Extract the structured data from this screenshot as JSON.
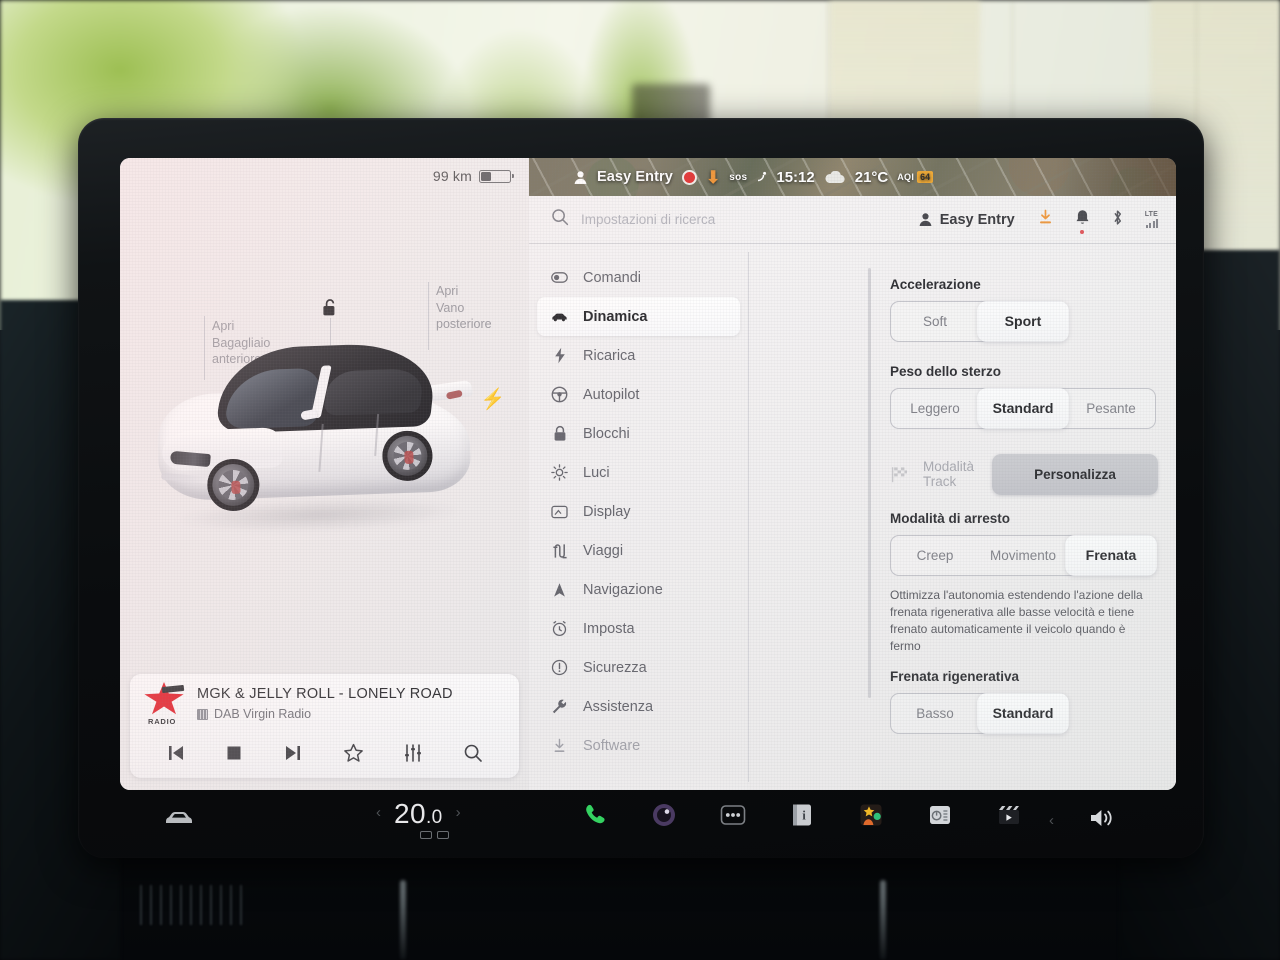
{
  "status_bar": {
    "profile_icon": "person-icon",
    "profile_name": "Easy Entry",
    "recording_icon": "record-dot-icon",
    "download_icon": "download-arrow-icon",
    "sos_label": "sos",
    "clock": "15:12",
    "weather_icon": "cloud-icon",
    "temperature": "21°C",
    "aqi_label": "AQI",
    "aqi_value": "64"
  },
  "car_panel": {
    "range": "99 km",
    "battery_percent": 35,
    "hint_left": "Apri\nBagagliaio\nanteriore",
    "hint_left_line1": "Apri",
    "hint_left_line2": "Bagagliaio",
    "hint_left_line3": "anteriore",
    "hint_right_line1": "Apri",
    "hint_right_line2": "Vano",
    "hint_right_line3": "posteriore",
    "lock_icon": "unlocked-padlock-icon",
    "charge_port_icon": "lightning-bolt-icon",
    "vehicle_image": "tesla-model-3-white"
  },
  "media": {
    "station_logo": "virgin-radio-logo",
    "logo_text": "RADIO",
    "track_title": "MGK & JELLY ROLL - LONELY ROAD",
    "source_icon": "dab-tuner-icon",
    "source": "DAB Virgin Radio",
    "controls": [
      {
        "name": "previous-track-button",
        "icon": "skip-back-icon"
      },
      {
        "name": "stop-button",
        "icon": "stop-square-icon"
      },
      {
        "name": "next-track-button",
        "icon": "skip-forward-icon"
      },
      {
        "name": "favorite-button",
        "icon": "star-outline-icon"
      },
      {
        "name": "equalizer-button",
        "icon": "sliders-icon"
      },
      {
        "name": "search-media-button",
        "icon": "search-icon"
      }
    ]
  },
  "search": {
    "icon": "search-icon",
    "placeholder": "Impostazioni di ricerca"
  },
  "header": {
    "account_icon": "person-icon",
    "account_name": "Easy Entry",
    "icons": [
      {
        "name": "software-download-icon",
        "color": "#f0912e"
      },
      {
        "name": "notification-bell-icon",
        "badge": true
      },
      {
        "name": "bluetooth-icon"
      },
      {
        "name": "lte-signal-icon",
        "label": "LTE"
      }
    ]
  },
  "menu": {
    "items": [
      {
        "label": "Comandi",
        "icon": "toggle-switch-icon",
        "state": "normal"
      },
      {
        "label": "Dinamica",
        "icon": "car-icon",
        "state": "active"
      },
      {
        "label": "Ricarica",
        "icon": "lightning-bolt-icon",
        "state": "normal"
      },
      {
        "label": "Autopilot",
        "icon": "steering-wheel-icon",
        "state": "normal"
      },
      {
        "label": "Blocchi",
        "icon": "padlock-icon",
        "state": "normal"
      },
      {
        "label": "Luci",
        "icon": "sun-lights-icon",
        "state": "normal"
      },
      {
        "label": "Display",
        "icon": "screen-icon",
        "state": "normal"
      },
      {
        "label": "Viaggi",
        "icon": "road-trip-icon",
        "state": "normal"
      },
      {
        "label": "Navigazione",
        "icon": "navigation-arrow-icon",
        "state": "normal"
      },
      {
        "label": "Imposta",
        "icon": "alarm-clock-icon",
        "state": "normal"
      },
      {
        "label": "Sicurezza",
        "icon": "alert-circle-icon",
        "state": "normal"
      },
      {
        "label": "Assistenza",
        "icon": "wrench-icon",
        "state": "normal"
      },
      {
        "label": "Software",
        "icon": "download-icon",
        "state": "dim"
      }
    ]
  },
  "settings": {
    "acceleration": {
      "label": "Accelerazione",
      "options": [
        "Soft",
        "Sport"
      ],
      "selected": "Sport"
    },
    "steering": {
      "label": "Peso dello sterzo",
      "options": [
        "Leggero",
        "Standard",
        "Pesante"
      ],
      "selected": "Standard"
    },
    "track_mode": {
      "icon": "checkered-flag-icon",
      "label": "Modalità Track",
      "button": "Personalizza",
      "disabled": true
    },
    "stopping_mode": {
      "label": "Modalità di arresto",
      "options": [
        "Creep",
        "Movimento",
        "Frenata"
      ],
      "selected": "Frenata",
      "description": "Ottimizza l'autonomia estendendo l'azione della frenata rigenerativa alle basse velocità e tiene frenato automaticamente il veicolo quando è fermo"
    },
    "regen_braking": {
      "label": "Frenata rigenerativa",
      "options": [
        "Basso",
        "Standard"
      ],
      "selected": "Standard"
    }
  },
  "taskbar": {
    "car_icon": "car-front-icon",
    "temp_left_chevron": "chevron-left-icon",
    "temperature": "20",
    "temperature_decimal": ".0",
    "temp_right_chevron": "chevron-right-icon",
    "seat_heater_left_icon": "seat-icon",
    "seat_heater_right_icon": "seat-icon",
    "apps": [
      {
        "name": "phone-app-icon",
        "icon": "phone-handset-icon"
      },
      {
        "name": "camera-app-icon",
        "icon": "camera-lens-icon"
      },
      {
        "name": "more-apps-icon",
        "icon": "three-dots-icon"
      },
      {
        "name": "manual-app-icon",
        "icon": "info-book-icon"
      },
      {
        "name": "arcade-app-icon",
        "icon": "games-icon"
      },
      {
        "name": "tuner-app-icon",
        "icon": "radio-tuner-icon"
      },
      {
        "name": "theater-app-icon",
        "icon": "film-clapper-icon"
      }
    ],
    "volume_chevron": "chevron-left-icon",
    "volume_icon": "speaker-volume-icon"
  },
  "colors": {
    "accent_orange": "#f0912e",
    "record_red": "#e02b2b",
    "notification_red": "#e0484d",
    "selected_text": "#18181c",
    "muted_text": "#9d9da5"
  }
}
